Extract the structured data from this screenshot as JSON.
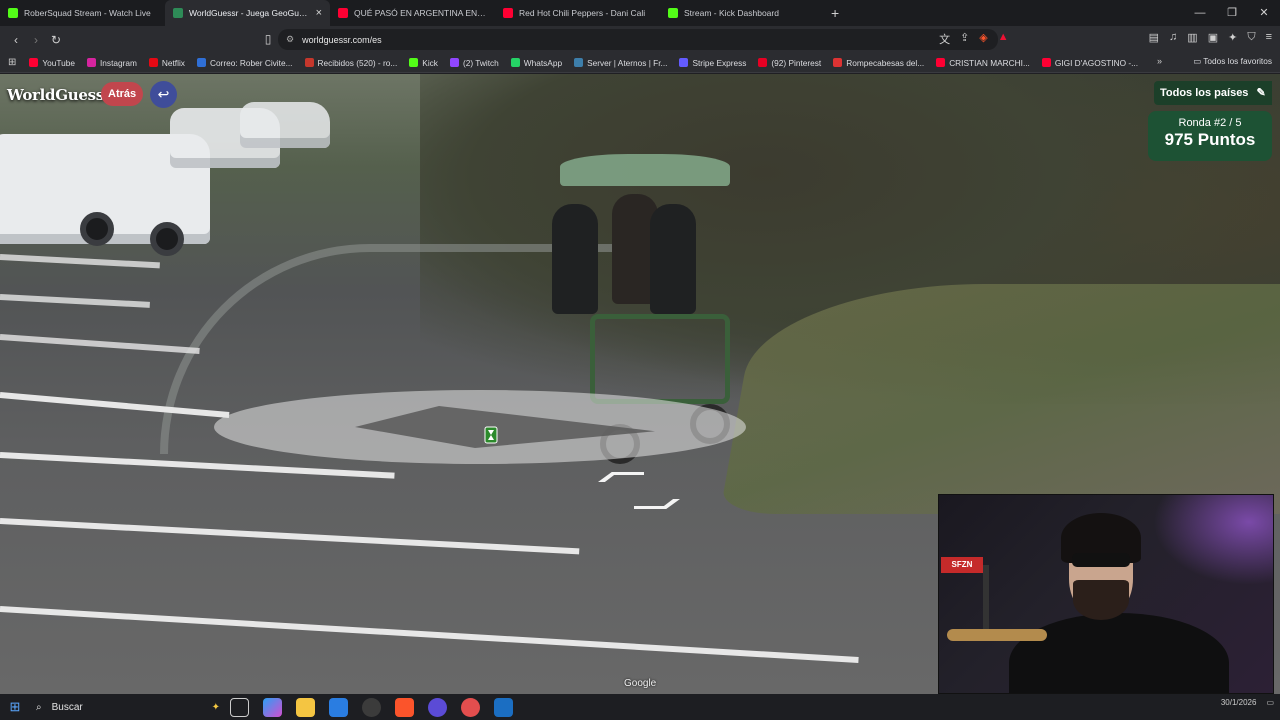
{
  "tabs": [
    {
      "title": "RoberSquad Stream - Watch Live",
      "favicon_color": "#53fc18",
      "active": false
    },
    {
      "title": "WorldGuessr - Juega GeoGuessr",
      "favicon_color": "#2e8b57",
      "active": true
    },
    {
      "title": "QUÉ PASÓ EN ARGENTINA EN FEBRE",
      "favicon_color": "#ff0033",
      "active": false
    },
    {
      "title": "Red Hot Chili Peppers - Dani Cali",
      "favicon_color": "#ff0033",
      "active": false
    },
    {
      "title": "Stream - Kick Dashboard",
      "favicon_color": "#53fc18",
      "active": false
    }
  ],
  "address": {
    "url": "worldguessr.com/es"
  },
  "bookmarks": [
    {
      "label": "YouTube",
      "color": "#ff0033"
    },
    {
      "label": "Instagram",
      "color": "#d6249f"
    },
    {
      "label": "Netflix",
      "color": "#e50914"
    },
    {
      "label": "Correo: Rober Civite...",
      "color": "#2f6fd6"
    },
    {
      "label": "Recibidos (520) - ro...",
      "color": "#c5372c"
    },
    {
      "label": "Kick",
      "color": "#53fc18"
    },
    {
      "label": "(2) Twitch",
      "color": "#9146ff"
    },
    {
      "label": "WhatsApp",
      "color": "#25d366"
    },
    {
      "label": "Server | Aternos | Fr...",
      "color": "#3d7eaa"
    },
    {
      "label": "Stripe Express",
      "color": "#635bff"
    },
    {
      "label": "(92) Pinterest",
      "color": "#e60023"
    },
    {
      "label": "Rompecabesas del...",
      "color": "#d33"
    },
    {
      "label": "CRISTIAN MARCHI...",
      "color": "#ff0033"
    },
    {
      "label": "GIGI D'AGOSTINO -...",
      "color": "#ff0033"
    }
  ],
  "bookmarks_all": "Todos los favoritos",
  "game": {
    "logo": "WorldGuessr",
    "back_label": "Atrás",
    "undo_icon": "↩",
    "countries_label": "Todos los países",
    "round_label": "Ronda #2 / 5",
    "points_label": "975 Puntos"
  },
  "map_attribution": "Google",
  "webcam": {
    "sign_text": "SFZN"
  },
  "taskbar": {
    "search_placeholder": "Buscar",
    "date": "30/1/2026"
  },
  "icons": {
    "back": "◁",
    "forward": "▷",
    "reload": "↻",
    "bookmark": "bookmark-icon",
    "pencil": "✎",
    "windows": "⊞",
    "search": "⌕"
  }
}
